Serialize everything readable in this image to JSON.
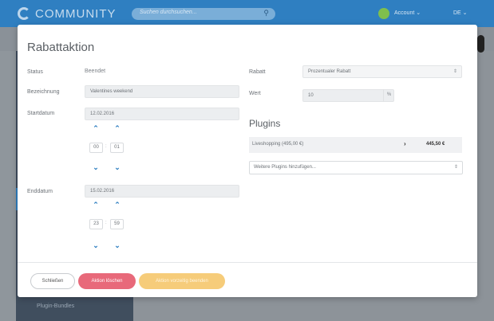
{
  "app": {
    "logo_text": "COMMUNITY",
    "search_placeholder": "Suchen durchsuchen...",
    "account_label": "Account",
    "language": "DE"
  },
  "sidebar": {
    "bottom_item": "Plugin-Bundles"
  },
  "modal": {
    "title": "Rabattaktion",
    "status_label": "Status",
    "status_value": "Beendet",
    "name_label": "Bezeichnung",
    "name_value": "Valentines weekend",
    "start_label": "Startdatum",
    "start_date": "12.02.2016",
    "start_hour": "00",
    "start_minute": "01",
    "end_label": "Enddatum",
    "end_date": "15.02.2016",
    "end_hour": "23",
    "end_minute": "59",
    "discount_label": "Rabatt",
    "discount_type": "Prozentualer Rabatt",
    "value_label": "Wert",
    "value": "10",
    "value_suffix": "%",
    "plugins_title": "Plugins",
    "plugin_name": "Liveshopping (495,00 €)",
    "plugin_chevron": "›",
    "plugin_price": "445,50 €",
    "more_plugins": "Weitere Plugins hinzufügen...",
    "btn_close": "Schließen",
    "btn_delete": "Aktion löschen",
    "btn_finish": "Aktion vorzeitig beenden"
  },
  "icons": {
    "up": "⌃",
    "down": "⌄",
    "select": "⇕",
    "search": "🔍"
  },
  "colors": {
    "accent": "#2f7fc1",
    "danger": "#e8697a",
    "warning": "#f6cc7a"
  }
}
